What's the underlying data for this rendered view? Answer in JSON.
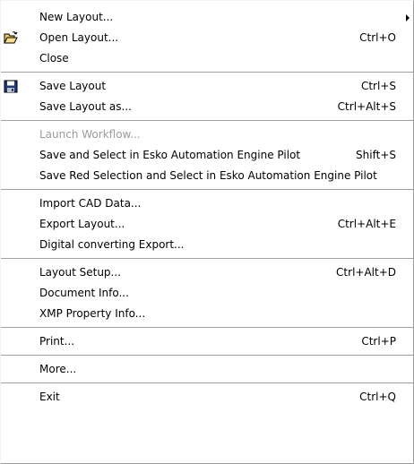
{
  "menu": {
    "groups": [
      [
        {
          "label": "New Layout...",
          "shortcut": "",
          "submenu": true,
          "icon": "",
          "enabled": true
        },
        {
          "label": "Open Layout...",
          "shortcut": "Ctrl+O",
          "submenu": false,
          "icon": "folder-open-icon",
          "enabled": true
        },
        {
          "label": "Close",
          "shortcut": "",
          "submenu": false,
          "icon": "",
          "enabled": true
        }
      ],
      [
        {
          "label": "Save Layout",
          "shortcut": "Ctrl+S",
          "submenu": false,
          "icon": "floppy-disk-icon",
          "enabled": true
        },
        {
          "label": "Save Layout as...",
          "shortcut": "Ctrl+Alt+S",
          "submenu": false,
          "icon": "",
          "enabled": true
        }
      ],
      [
        {
          "label": "Launch Workflow...",
          "shortcut": "",
          "submenu": false,
          "icon": "",
          "enabled": false
        },
        {
          "label": "Save and Select in Esko Automation Engine Pilot",
          "shortcut": "Shift+S",
          "submenu": false,
          "icon": "",
          "enabled": true
        },
        {
          "label": "Save Red Selection and Select in Esko Automation Engine Pilot",
          "shortcut": "",
          "submenu": false,
          "icon": "",
          "enabled": true
        }
      ],
      [
        {
          "label": "Import CAD Data...",
          "shortcut": "",
          "submenu": false,
          "icon": "",
          "enabled": true
        },
        {
          "label": "Export Layout...",
          "shortcut": "Ctrl+Alt+E",
          "submenu": false,
          "icon": "",
          "enabled": true
        },
        {
          "label": "Digital converting Export...",
          "shortcut": "",
          "submenu": false,
          "icon": "",
          "enabled": true
        }
      ],
      [
        {
          "label": "Layout Setup...",
          "shortcut": "Ctrl+Alt+D",
          "submenu": false,
          "icon": "",
          "enabled": true
        },
        {
          "label": "Document Info...",
          "shortcut": "",
          "submenu": false,
          "icon": "",
          "enabled": true
        },
        {
          "label": "XMP Property Info...",
          "shortcut": "",
          "submenu": false,
          "icon": "",
          "enabled": true
        }
      ],
      [
        {
          "label": "Print...",
          "shortcut": "Ctrl+P",
          "submenu": false,
          "icon": "",
          "enabled": true
        }
      ],
      [
        {
          "label": "More...",
          "shortcut": "",
          "submenu": false,
          "icon": "",
          "enabled": true
        }
      ],
      [
        {
          "label": "Exit",
          "shortcut": "Ctrl+Q",
          "submenu": false,
          "icon": "",
          "enabled": true
        }
      ]
    ],
    "colors": {
      "background": "#ffffff",
      "text": "#000000",
      "disabled_text": "#9c9c9c",
      "separator": "#a0a0a0"
    }
  }
}
